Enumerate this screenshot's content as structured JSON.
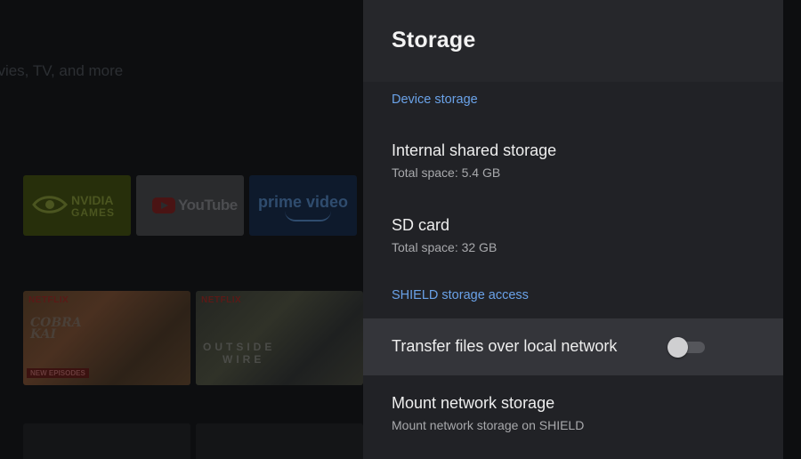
{
  "home": {
    "tagline": "ovies, TV, and more",
    "apps": [
      {
        "name": "NVIDIA GAMES",
        "word1": "NVIDIA",
        "word2": "GAMES"
      },
      {
        "name": "YouTube",
        "word": "YouTube"
      },
      {
        "name": "prime video",
        "word": "prime video"
      }
    ],
    "cards": [
      {
        "brand": "NETFLIX",
        "title_line1": "COBRA",
        "title_line2": "KAI",
        "badge": "NEW EPISODES"
      },
      {
        "brand": "NETFLIX",
        "title_line1": "OUTSIDE",
        "title_line2": "WIRE"
      }
    ]
  },
  "panel": {
    "title": "Storage",
    "sections": {
      "device": "Device storage",
      "shield": "SHIELD storage access"
    },
    "items": {
      "internal": {
        "title": "Internal shared storage",
        "subtitle": "Total space: 5.4 GB"
      },
      "sd": {
        "title": "SD card",
        "subtitle": "Total space: 32 GB"
      },
      "transfer": {
        "title": "Transfer files over local network",
        "toggle_state": "off"
      },
      "mount": {
        "title": "Mount network storage",
        "subtitle": "Mount network storage on SHIELD"
      }
    }
  },
  "colors": {
    "accent": "#6aa2e8",
    "panel_bg": "#212226",
    "focused_item_bg": "#34353a"
  }
}
